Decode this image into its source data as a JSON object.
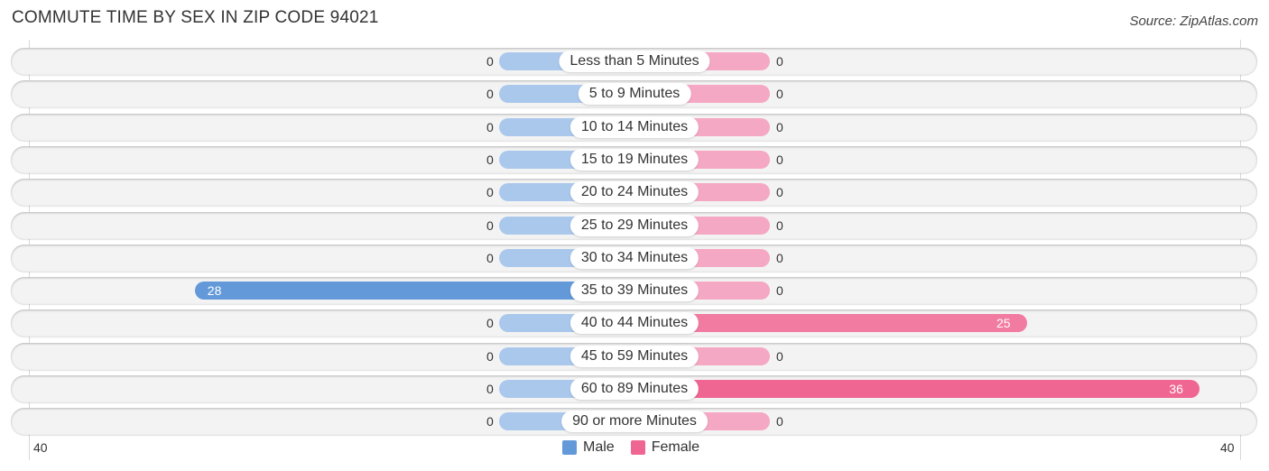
{
  "title": "COMMUTE TIME BY SEX IN ZIP CODE 94021",
  "source": "Source: ZipAtlas.com",
  "colors": {
    "male": "#6399d9",
    "male_light": "#aac8ec",
    "female": "#ef6693",
    "female_light": "#f5a8c3"
  },
  "chart_data": {
    "type": "bar",
    "orientation": "horizontal-diverging",
    "title": "COMMUTE TIME BY SEX IN ZIP CODE 94021",
    "categories": [
      "Less than 5 Minutes",
      "5 to 9 Minutes",
      "10 to 14 Minutes",
      "15 to 19 Minutes",
      "20 to 24 Minutes",
      "25 to 29 Minutes",
      "30 to 34 Minutes",
      "35 to 39 Minutes",
      "40 to 44 Minutes",
      "45 to 59 Minutes",
      "60 to 89 Minutes",
      "90 or more Minutes"
    ],
    "series": [
      {
        "name": "Male",
        "values": [
          0,
          0,
          0,
          0,
          0,
          0,
          0,
          28,
          0,
          0,
          0,
          0
        ]
      },
      {
        "name": "Female",
        "values": [
          0,
          0,
          0,
          0,
          0,
          0,
          0,
          0,
          25,
          0,
          36,
          0
        ]
      }
    ],
    "axis": {
      "left_tick": "40",
      "right_tick": "40",
      "range": [
        -40,
        40
      ]
    },
    "legend": [
      "Male",
      "Female"
    ],
    "legend_position": "bottom-center"
  }
}
